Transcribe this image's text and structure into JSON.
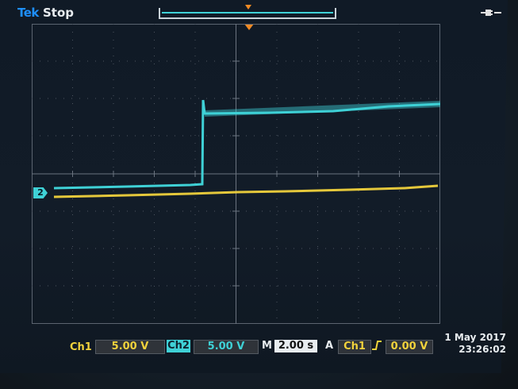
{
  "header": {
    "brand": "Tek",
    "state": "Stop"
  },
  "channel_marker": "2",
  "readout": {
    "ch1_label": "Ch1",
    "ch1_scale": "5.00 V",
    "ch2_label": "Ch2",
    "ch2_scale": "5.00 V",
    "time_label": "M",
    "time_scale": "2.00 s",
    "trigger_label": "A",
    "trigger_source": "Ch1",
    "trigger_level": "0.00 V",
    "date": "1 May 2017",
    "time": "23:26:02"
  },
  "colors": {
    "ch1": "#f1d23c",
    "ch2": "#3fd1d6",
    "trigger": "#f08a24",
    "brand": "#1e90ff"
  },
  "icons": {
    "power": "plug-icon",
    "trigger_edge": "rising-edge-icon"
  }
}
